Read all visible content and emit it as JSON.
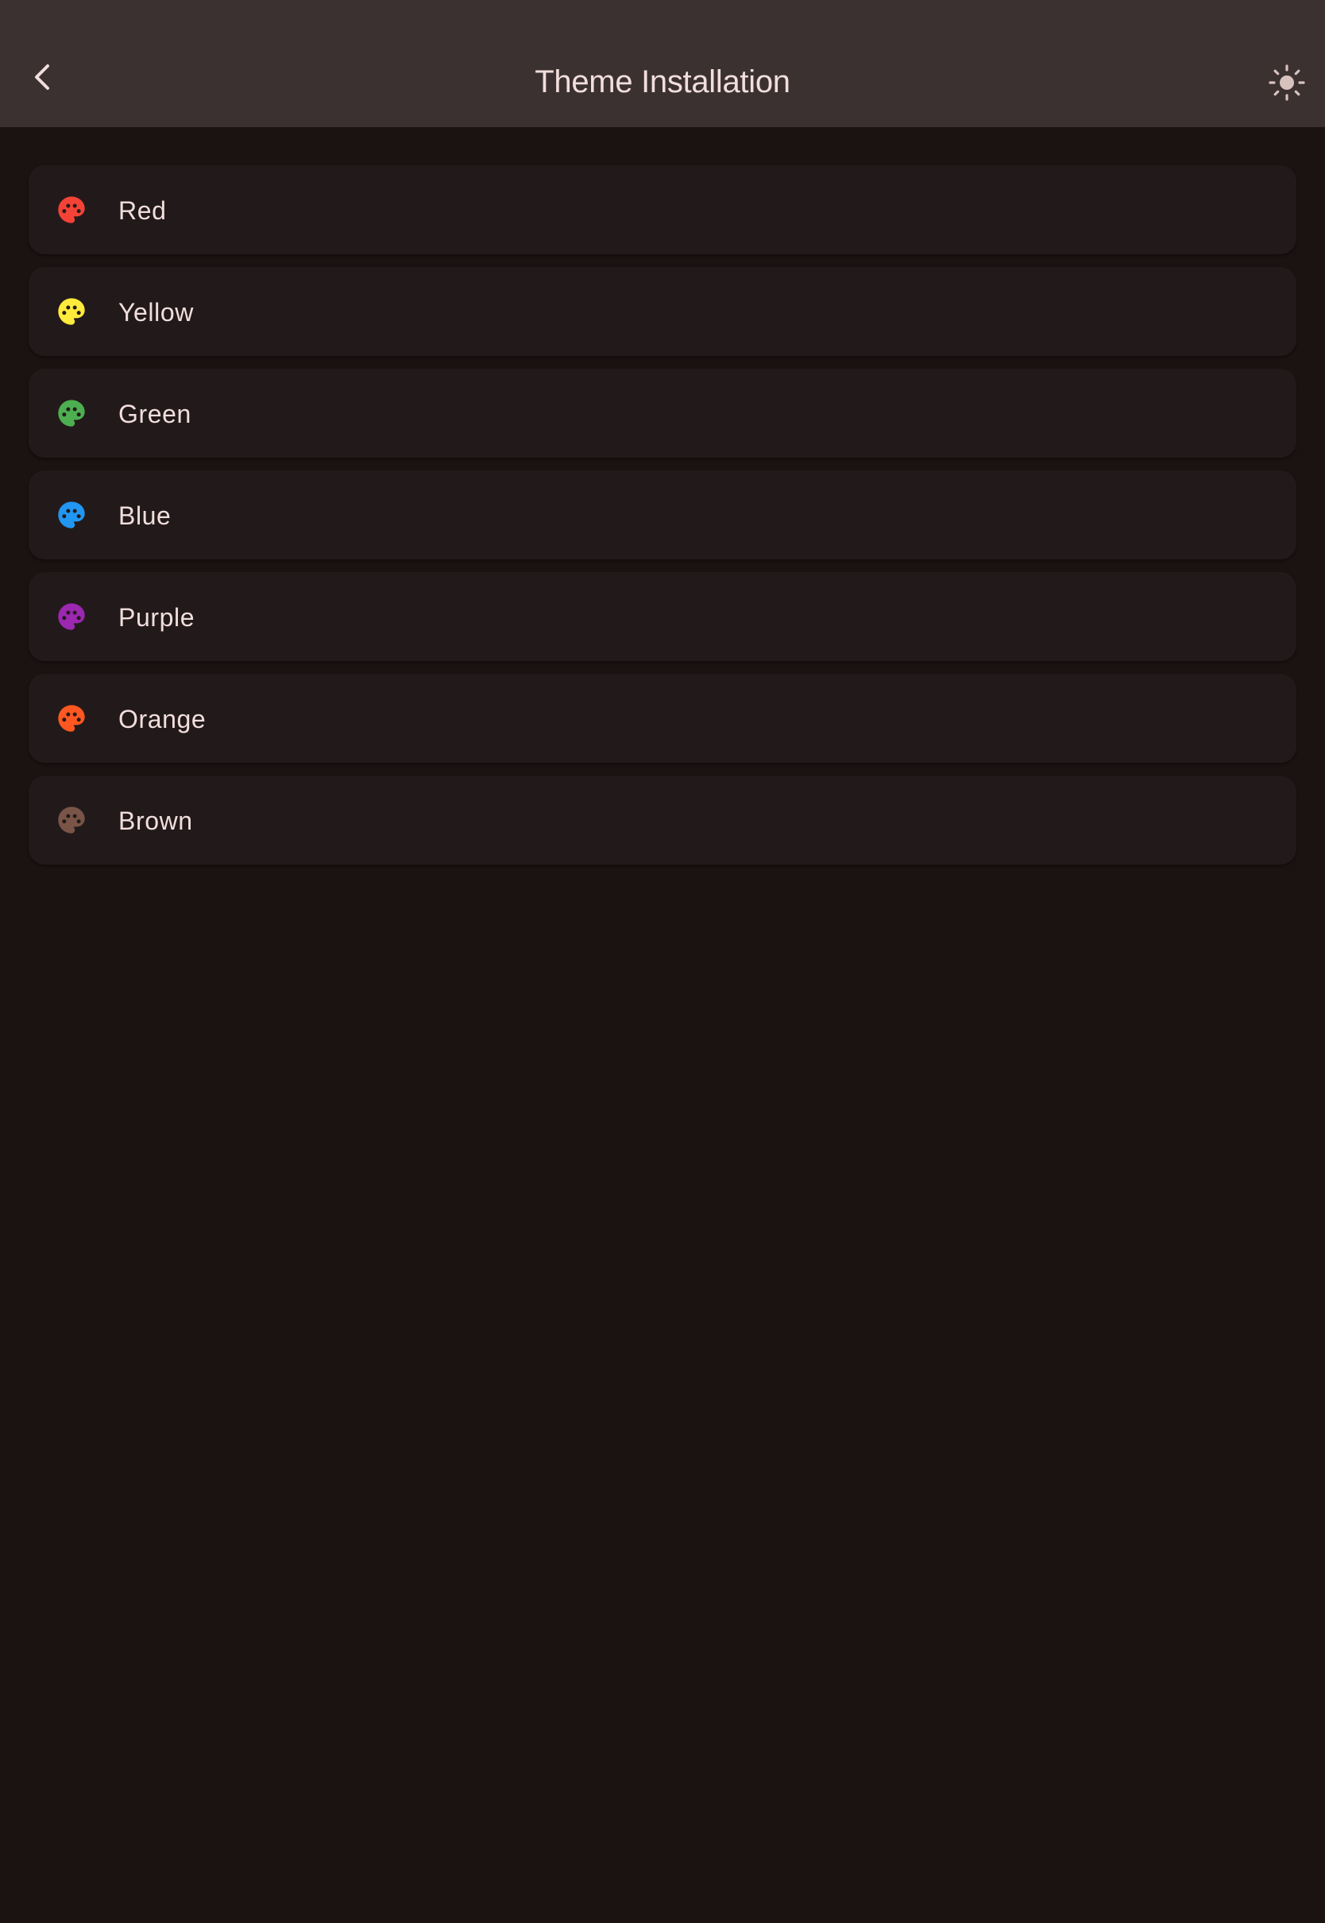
{
  "header": {
    "title": "Theme Installation",
    "back_icon": "chevron-left-icon",
    "theme_toggle_icon": "sun-icon"
  },
  "colors": {
    "appbar_bg": "#3c3131",
    "page_bg": "#1b1212",
    "card_bg": "#221a1a",
    "text": "#f1dedd",
    "icon_tint": "#d8c2be"
  },
  "themes": [
    {
      "label": "Red",
      "color": "#f44336",
      "icon": "palette-icon"
    },
    {
      "label": "Yellow",
      "color": "#ffeb3b",
      "icon": "palette-icon"
    },
    {
      "label": "Green",
      "color": "#4caf50",
      "icon": "palette-icon"
    },
    {
      "label": "Blue",
      "color": "#2196f3",
      "icon": "palette-icon"
    },
    {
      "label": "Purple",
      "color": "#9c27b0",
      "icon": "palette-icon"
    },
    {
      "label": "Orange",
      "color": "#ff5722",
      "icon": "palette-icon"
    },
    {
      "label": "Brown",
      "color": "#795548",
      "icon": "palette-icon"
    }
  ]
}
